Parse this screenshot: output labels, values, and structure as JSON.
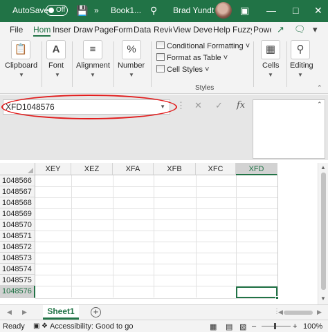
{
  "titlebar": {
    "autosave_label": "AutoSave",
    "autosave_state": "Off",
    "book_title": "Book1...",
    "user_name": "Brad Yundt"
  },
  "tabs": [
    {
      "label": "File"
    },
    {
      "label": "Hom"
    },
    {
      "label": "Inser"
    },
    {
      "label": "Draw"
    },
    {
      "label": "Page"
    },
    {
      "label": "Form"
    },
    {
      "label": "Data"
    },
    {
      "label": "Revie"
    },
    {
      "label": "View"
    },
    {
      "label": "Deve"
    },
    {
      "label": "Help"
    },
    {
      "label": "Fuzzy"
    },
    {
      "label": "Powe"
    }
  ],
  "ribbon": {
    "clipboard": "Clipboard",
    "font": "Font",
    "alignment": "Alignment",
    "number": "Number",
    "conditional_formatting": "Conditional Formatting",
    "format_as_table": "Format as Table",
    "cell_styles": "Cell Styles",
    "styles_group": "Styles",
    "cells": "Cells",
    "editing": "Editing"
  },
  "formula_bar": {
    "name_box": "XFD1048576",
    "fx": "fx",
    "value": ""
  },
  "grid": {
    "columns": [
      "XEY",
      "XEZ",
      "XFA",
      "XFB",
      "XFC",
      "XFD"
    ],
    "selected_column": "XFD",
    "rows": [
      "1048566",
      "1048567",
      "1048568",
      "1048569",
      "1048570",
      "1048571",
      "1048572",
      "1048573",
      "1048574",
      "1048575",
      "1048576"
    ],
    "selected_row": "1048576"
  },
  "sheets": [
    {
      "name": "Sheet1"
    }
  ],
  "status": {
    "ready": "Ready",
    "accessibility": "Accessibility: Good to go",
    "zoom": "100%"
  },
  "colors": {
    "excel_green": "#217346",
    "annotation_red": "#e11c1c"
  }
}
